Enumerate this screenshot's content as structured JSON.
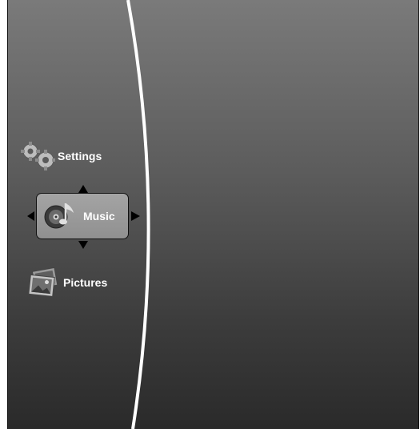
{
  "menu": {
    "items": [
      {
        "label": "Settings",
        "icon": "gears-icon",
        "selected": false
      },
      {
        "label": "Music",
        "icon": "music-disc-icon",
        "selected": true
      },
      {
        "label": "Pictures",
        "icon": "photos-icon",
        "selected": false
      }
    ]
  },
  "colors": {
    "background_top": "#7a7a7a",
    "background_bottom": "#2a2a2a",
    "divider": "#ffffff",
    "selection": "#9a9a9a",
    "text": "#ffffff"
  }
}
